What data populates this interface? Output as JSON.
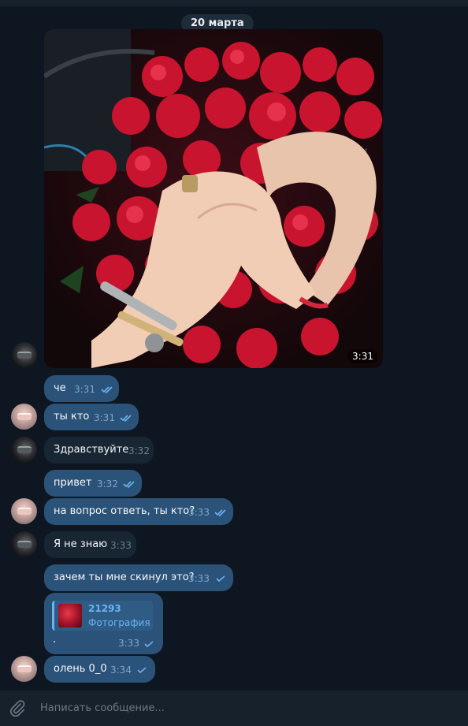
{
  "date_separator": "20 марта",
  "photo_message": {
    "time": "3:31"
  },
  "messages": [
    {
      "text": "че",
      "time": "3:31",
      "status": "read"
    },
    {
      "text": "ты кто",
      "time": "3:31",
      "status": "read"
    },
    {
      "text": "Здравствуйте",
      "time": "3:32"
    },
    {
      "text": "привет",
      "time": "3:32",
      "status": "read"
    },
    {
      "text": "на вопрос ответь, ты кто?",
      "time": "3:33",
      "status": "read"
    },
    {
      "text": "Я не знаю",
      "time": "3:33"
    },
    {
      "text": "зачем ты мне скинул это?",
      "time": "3:33",
      "status": "sent"
    },
    {
      "text": "олень 0_0",
      "time": "3:34",
      "status": "sent"
    }
  ],
  "forwarded": {
    "title": "21293",
    "subtitle": "Фотография",
    "text": ".",
    "time": "3:33",
    "status": "sent"
  },
  "composer": {
    "placeholder": "Написать сообщение..."
  },
  "icons": {
    "attach": "paperclip-icon",
    "read": "double-check-icon",
    "sent": "check-icon"
  },
  "colors": {
    "background": "#0e1621",
    "outgoing": "#2b5278",
    "incoming": "#182533",
    "accent": "#6ab3f3"
  }
}
